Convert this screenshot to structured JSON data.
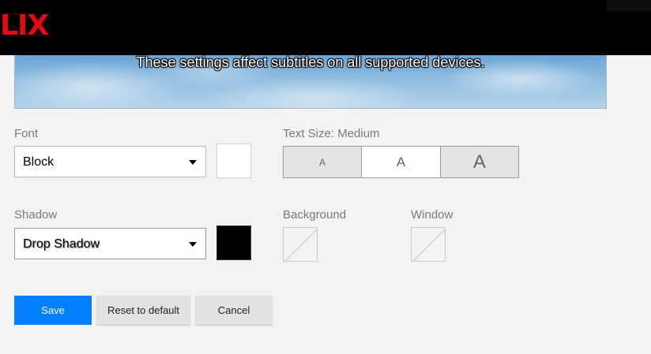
{
  "brand": {
    "logo_text": "LIX",
    "color": "#e50914"
  },
  "preview": {
    "text": "These settings affect subtitles on all supported devices."
  },
  "font": {
    "label": "Font",
    "value": "Block",
    "color": "#ffffff"
  },
  "text_size": {
    "label": "Text Size: Medium",
    "options": [
      "A",
      "A",
      "A"
    ],
    "selected_index": 1
  },
  "shadow": {
    "label": "Shadow",
    "value": "Drop Shadow",
    "color": "#000000"
  },
  "background": {
    "label": "Background"
  },
  "window": {
    "label": "Window"
  },
  "buttons": {
    "save": "Save",
    "reset": "Reset to default",
    "cancel": "Cancel"
  },
  "colors": {
    "save_button": "#0080ff",
    "page_background": "#f3f3f3",
    "header": "#000000"
  }
}
